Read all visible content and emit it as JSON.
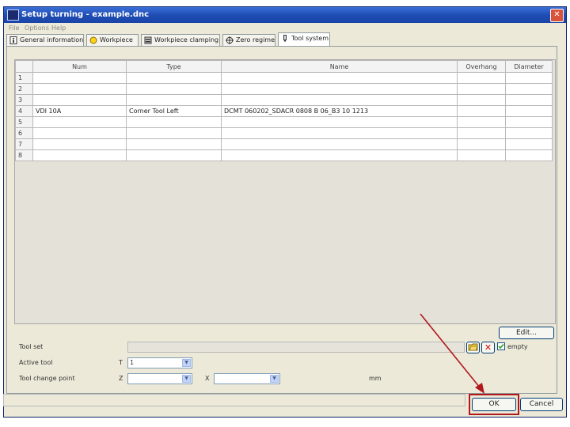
{
  "window": {
    "title": "Setup turning - example.dnc",
    "close_glyph": "✕"
  },
  "menu": [
    "File",
    "Options",
    "Help"
  ],
  "tabs": [
    {
      "label": "General information",
      "icon": "info-icon"
    },
    {
      "label": "Workpiece",
      "icon": "workpiece-icon"
    },
    {
      "label": "Workpiece clamping",
      "icon": "clamp-icon"
    },
    {
      "label": "Zero regime",
      "icon": "zero-point-icon"
    },
    {
      "label": "Tool system",
      "icon": "tool-icon",
      "active": true
    }
  ],
  "table": {
    "headers": [
      "Num",
      "Type",
      "Name",
      "Overhang",
      "Diameter"
    ],
    "rows": [
      {
        "n": "1",
        "num": "",
        "type": "",
        "name": "",
        "overhang": "",
        "diameter": ""
      },
      {
        "n": "2",
        "num": "",
        "type": "",
        "name": "",
        "overhang": "",
        "diameter": ""
      },
      {
        "n": "3",
        "num": "",
        "type": "",
        "name": "",
        "overhang": "",
        "diameter": ""
      },
      {
        "n": "4",
        "num": "VDI 10A",
        "type": "Corner Tool Left",
        "name": "DCMT 060202_SDACR 0808 B 06_B3 10 1213",
        "overhang": "",
        "diameter": ""
      },
      {
        "n": "5",
        "num": "",
        "type": "",
        "name": "",
        "overhang": "",
        "diameter": ""
      },
      {
        "n": "6",
        "num": "",
        "type": "",
        "name": "",
        "overhang": "",
        "diameter": ""
      },
      {
        "n": "7",
        "num": "",
        "type": "",
        "name": "",
        "overhang": "",
        "diameter": ""
      },
      {
        "n": "8",
        "num": "",
        "type": "",
        "name": "",
        "overhang": "",
        "diameter": ""
      }
    ]
  },
  "form": {
    "edit_label": "Edit...",
    "tool_set_label": "Tool set",
    "empty_label": "empty",
    "empty_checked": true,
    "active_tool_label": "Active tool",
    "active_tool_prefix": "T",
    "active_tool_value": "1",
    "tool_change_label": "Tool change point",
    "z_prefix": "Z",
    "x_prefix": "X",
    "unit": "mm"
  },
  "footer": {
    "ok_label": "OK",
    "cancel_label": "Cancel"
  },
  "colors": {
    "title_bar": "#1f4db3",
    "highlight": "#b0181e"
  }
}
